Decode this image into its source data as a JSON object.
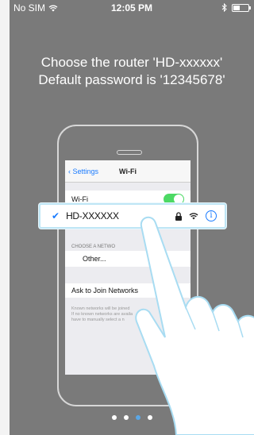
{
  "status_bar": {
    "carrier": "No SIM",
    "time": "12:05 PM"
  },
  "instructions": {
    "line1": "Choose the router 'HD-xxxxxx'",
    "line2": "Default password is '12345678'"
  },
  "illustration": {
    "nav": {
      "back_label": "Settings",
      "title": "Wi-Fi"
    },
    "wifi_row_label": "Wi-Fi",
    "wifi_toggle_on": true,
    "section_label": "CHOOSE A NETWO",
    "other_label": "Other...",
    "ask_label": "Ask to Join Networks",
    "note_lines": [
      "Known networks will be joined",
      "If no known networks are availa",
      "have to manually select a n"
    ],
    "selected_network": {
      "ssid": "HD-XXXXXX"
    }
  },
  "pagination": {
    "total": 4,
    "active_index": 2
  },
  "colors": {
    "background": "#7a7a7a",
    "accent": "#1a7bff",
    "toggle_on": "#4cd964",
    "highlight_border": "#bfe6f5",
    "active_dot": "#5aa7e6"
  }
}
